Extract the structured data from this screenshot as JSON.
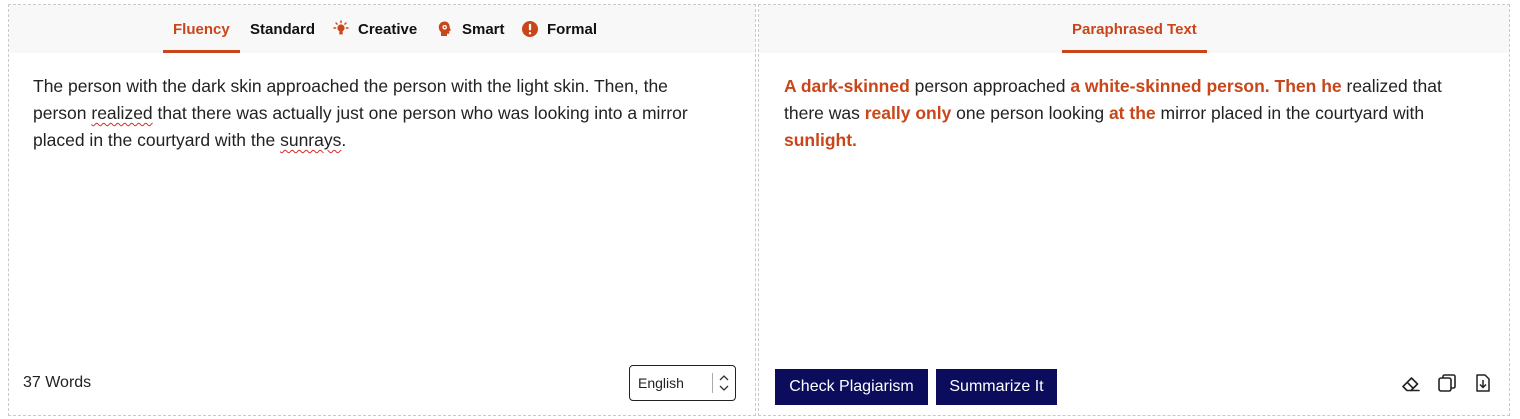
{
  "left_panel": {
    "tabs": [
      {
        "label": "Fluency",
        "active": true,
        "icon": null
      },
      {
        "label": "Standard",
        "active": false,
        "icon": null
      },
      {
        "label": "Creative",
        "active": false,
        "icon": "lightbulb-icon"
      },
      {
        "label": "Smart",
        "active": false,
        "icon": "brain-head-icon"
      },
      {
        "label": "Formal",
        "active": false,
        "icon": "exclamation-circle-icon"
      }
    ],
    "input_text": {
      "part1": "The person with the dark skin approached the person with the light skin. Then, the person ",
      "word_realized": "realized",
      "part2": " that there was actually just one person who was looking into a mirror placed in the courtyard with the ",
      "word_sunrays": "sunrays",
      "part3": "."
    },
    "word_count": "37 Words",
    "language": "English"
  },
  "right_panel": {
    "tab": "Paraphrased Text",
    "output_segments": [
      {
        "text": "A dark-skinned",
        "changed": true
      },
      {
        "text": " person approached ",
        "changed": false
      },
      {
        "text": "a white-skinned person. Then he",
        "changed": true
      },
      {
        "text": " realized that there was ",
        "changed": false
      },
      {
        "text": "really only",
        "changed": true
      },
      {
        "text": " one person looking ",
        "changed": false
      },
      {
        "text": "at the",
        "changed": true
      },
      {
        "text": " mirror placed in the courtyard with ",
        "changed": false
      },
      {
        "text": "sunlight.",
        "changed": true
      }
    ],
    "buttons": {
      "check_plagiarism": "Check Plagiarism",
      "summarize": "Summarize It"
    },
    "tools": [
      "eraser-icon",
      "copy-icon",
      "download-icon"
    ]
  },
  "colors": {
    "accent": "#c9461a",
    "button_bg": "#0c0c5c"
  }
}
